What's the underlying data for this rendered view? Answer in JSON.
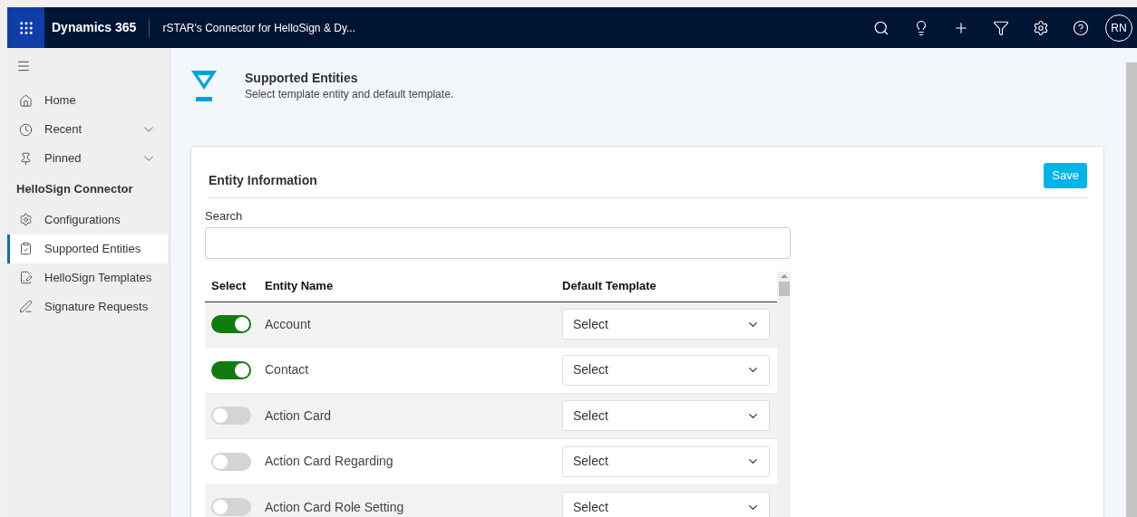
{
  "header": {
    "app_name": "Dynamics 365",
    "app_title": "rSTAR's Connector for HelloSign & Dy...",
    "avatar": "RN"
  },
  "sidebar": {
    "items": [
      {
        "label": "Home",
        "kind": "home",
        "expandable": false,
        "selected": false
      },
      {
        "label": "Recent",
        "kind": "recent",
        "expandable": true,
        "selected": false
      },
      {
        "label": "Pinned",
        "kind": "pinned",
        "expandable": true,
        "selected": false
      }
    ],
    "section_title": "HelloSign Connector",
    "section_items": [
      {
        "label": "Configurations",
        "kind": "settings",
        "selected": false
      },
      {
        "label": "Supported Entities",
        "kind": "clipboard",
        "selected": true
      },
      {
        "label": "HelloSign Templates",
        "kind": "template",
        "selected": false
      },
      {
        "label": "Signature Requests",
        "kind": "signature",
        "selected": false
      }
    ]
  },
  "page": {
    "title": "Supported Entities",
    "subtitle": "Select template entity and default template."
  },
  "card": {
    "title": "Entity Information",
    "save_button": "Save",
    "search_label": "Search",
    "table": {
      "columns": [
        "Select",
        "Entity Name",
        "Default Template"
      ],
      "rows": [
        {
          "on": true,
          "name": "Account",
          "template": "Select"
        },
        {
          "on": true,
          "name": "Contact",
          "template": "Select"
        },
        {
          "on": false,
          "name": "Action Card",
          "template": "Select"
        },
        {
          "on": false,
          "name": "Action Card Regarding",
          "template": "Select"
        },
        {
          "on": false,
          "name": "Action Card Role Setting",
          "template": "Select"
        }
      ]
    }
  }
}
